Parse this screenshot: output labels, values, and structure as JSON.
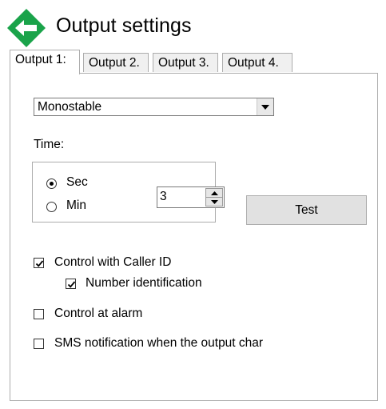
{
  "header": {
    "title": "Output settings"
  },
  "tabs": [
    "Output 1:",
    "Output 2.",
    "Output 3.",
    "Output 4."
  ],
  "mode_select": {
    "value": "Monostable"
  },
  "time": {
    "label": "Time:",
    "units": [
      {
        "label": "Sec",
        "selected": true
      },
      {
        "label": "Min",
        "selected": false
      }
    ],
    "value": "3"
  },
  "test_button": "Test",
  "options": {
    "caller_id": {
      "label": "Control with Caller ID",
      "checked": true
    },
    "number_id": {
      "label": "Number identification",
      "checked": true
    },
    "alarm": {
      "label": "Control at alarm",
      "checked": false
    },
    "sms": {
      "label": "SMS notification when the output char",
      "checked": false
    }
  },
  "colors": {
    "back_icon_green": "#1aa34a",
    "panel_border": "#adadad"
  }
}
